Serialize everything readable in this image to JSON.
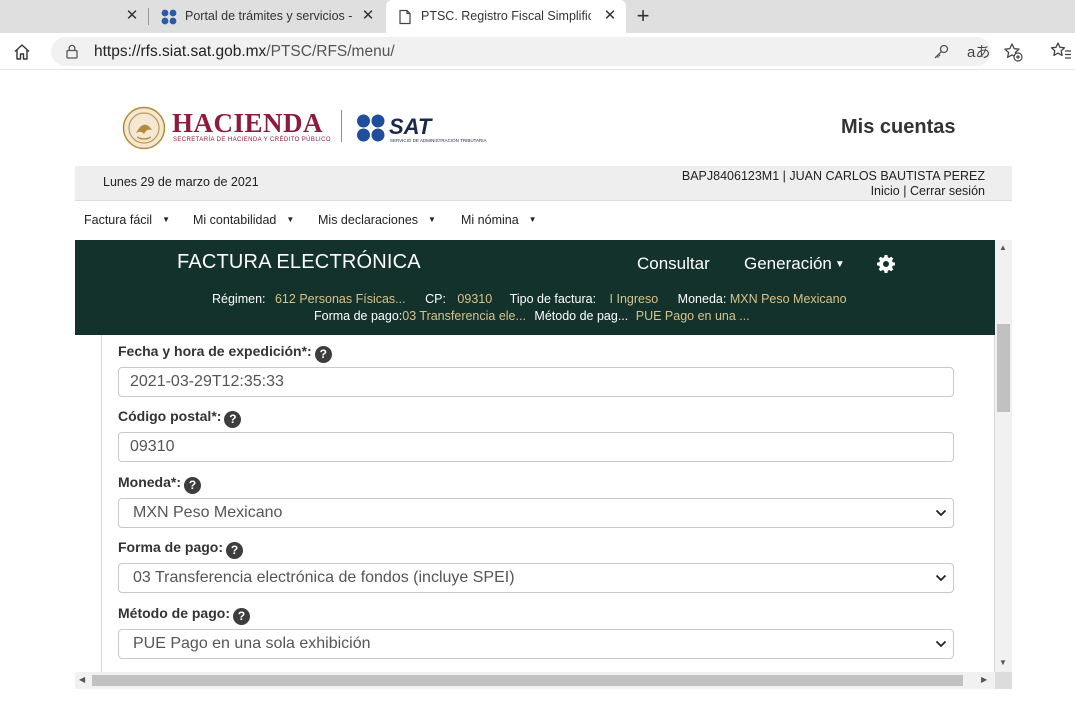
{
  "browser": {
    "tabs": [
      {
        "title": "",
        "active": false
      },
      {
        "title": "Portal de trámites y servicios - SAT",
        "active": false
      },
      {
        "title": "PTSC. Registro Fiscal Simplificado",
        "active": true
      }
    ],
    "url_domain": "https://rfs.siat.sat.gob.mx",
    "url_path": "/PTSC/RFS/menu/",
    "translate_glyph": "aあ"
  },
  "header": {
    "hacienda": "HACIENDA",
    "hacienda_sub": "SECRETARÍA DE HACIENDA Y CRÉDITO PÚBLICO",
    "sat": "SAT",
    "sat_sub": "SERVICIO DE ADMINISTRACIÓN TRIBUTARIA",
    "mis_cuentas": "Mis cuentas"
  },
  "userbar": {
    "date": "Lunes 29 de marzo de 2021",
    "rfc_name": "BAPJ8406123M1 | JUAN CARLOS BAUTISTA PEREZ",
    "inicio": "Inicio",
    "sep": "|",
    "cerrar": "Cerrar sesión"
  },
  "menu": {
    "items": [
      "Factura fácil",
      "Mi contabilidad",
      "Mis declaraciones",
      "Mi nómina"
    ]
  },
  "factura": {
    "title": "FACTURA ELECTRÓNICA",
    "nav_consultar": "Consultar",
    "nav_generacion": "Generación",
    "regimen_label": "Régimen:",
    "regimen_value": "612 Personas Físicas...",
    "cp_label": "CP:",
    "cp_value": "09310",
    "tipo_label": "Tipo de factura:",
    "tipo_value": "I Ingreso",
    "moneda_label": "Moneda:",
    "moneda_value": "MXN Peso Mexicano",
    "forma_label": "Forma de pago:",
    "forma_value": "03 Transferencia ele...",
    "metodo_label": "Método de pag...",
    "metodo_value": "PUE Pago en una ..."
  },
  "form": {
    "fecha_label": "Fecha y hora de expedición*:",
    "fecha_value": "2021-03-29T12:35:33",
    "cp_label": "Código postal*:",
    "cp_value": "09310",
    "moneda_label": "Moneda*:",
    "moneda_value": "MXN Peso Mexicano",
    "forma_label": "Forma de pago:",
    "forma_value": "03 Transferencia electrónica de fondos (incluye SPEI)",
    "metodo_label": "Método de pago:",
    "metodo_value": "PUE Pago en una sola exhibición",
    "help_glyph": "?"
  }
}
